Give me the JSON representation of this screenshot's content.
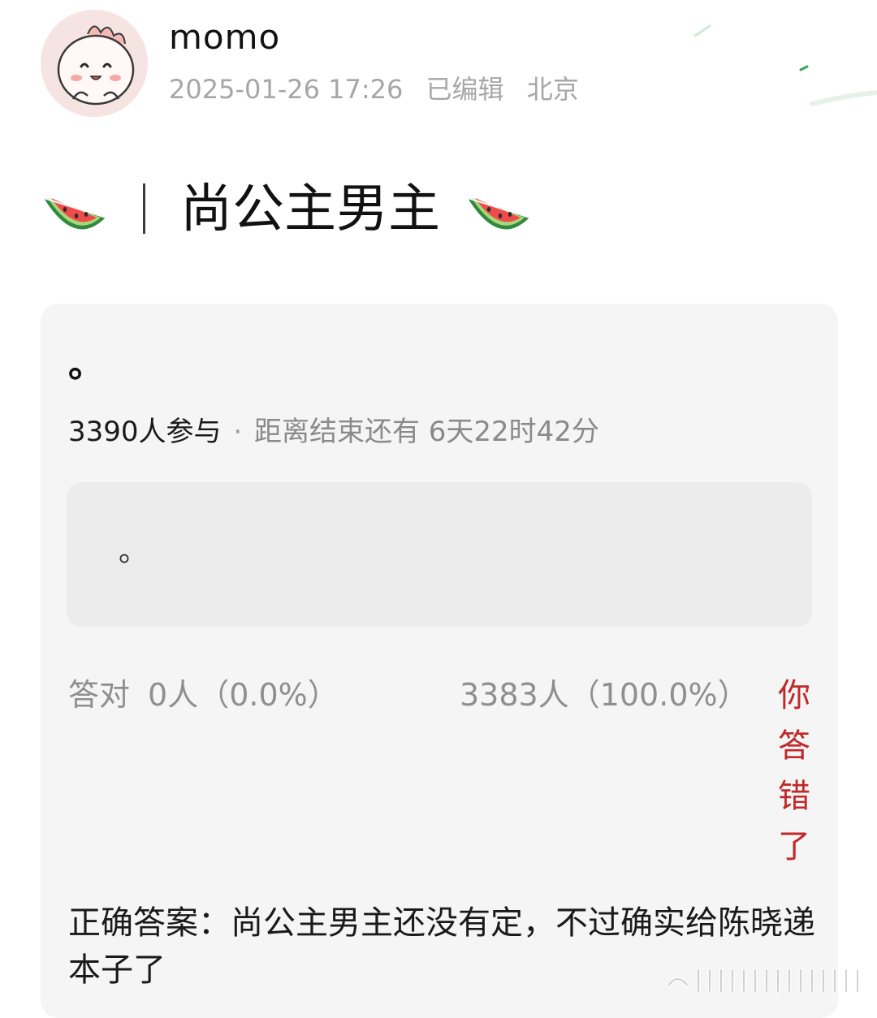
{
  "post": {
    "author": {
      "name": "momo",
      "avatar_icon": "cartoon-dinosaur-avatar-icon"
    },
    "meta": {
      "datetime": "2025-01-26 17:26",
      "edited": "已编辑",
      "location": "北京"
    },
    "title": {
      "text": "尚公主男主",
      "decoration_icon": "watermelon-icon"
    }
  },
  "quiz": {
    "question": "。",
    "participants": "3390人参与",
    "separator": "·",
    "countdown": "距离结束还有 6天22时42分",
    "option": "。",
    "correct_result": {
      "label": "答对",
      "value": "0人（0.0%）"
    },
    "wrong_result": {
      "value": "3383人（100.0%）",
      "label": "你答错了"
    },
    "answer": "正确答案：尚公主男主还没有定，不过确实给陈晓递本子了"
  },
  "colors": {
    "card_background": "#f5f5f5",
    "option_background": "#ececec",
    "wrong_label": "#c0282a",
    "muted_text": "#8f8f8f"
  }
}
